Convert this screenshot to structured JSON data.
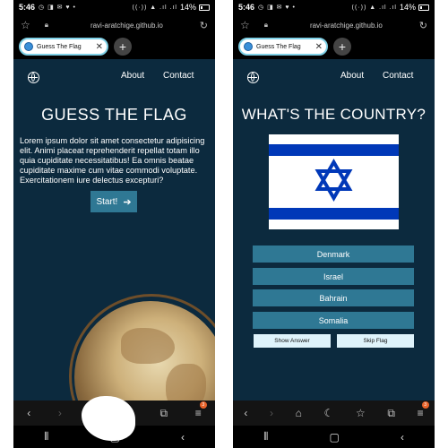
{
  "status_bar": {
    "time": "5:46",
    "notification_glyphs": "◷ ◨ ✉ ♥ •",
    "signal_glyphs": "((·)) ▲ .ıl .ıl",
    "battery": "14%"
  },
  "browser": {
    "url": "ravi-aratchige.github.io",
    "tab_title": "Guess The Flag"
  },
  "nav": {
    "about": "About",
    "contact": "Contact"
  },
  "landing": {
    "title": "GUESS THE FLAG",
    "text": "Lorem ipsum dolor sit amet consectetur adipisicing elit. Animi placeat reprehenderit repellat totam illo quia cupiditate necessitatibus! Ea omnis beatae cupiditate maxime cum vitae commodi voluptate. Exercitationem iure delectus excepturi?",
    "start_label": "Start!"
  },
  "quiz": {
    "title": "WHAT'S THE COUNTRY?",
    "flag_icon": "flag-of-israel",
    "answers": [
      "Denmark",
      "Israel",
      "Bahrain",
      "Somalia"
    ],
    "show_answer_label": "Show Answer",
    "skip_flag_label": "Skip Flag"
  },
  "browser_menu_badge": "3",
  "colors": {
    "page_bg": "#0c2a3e",
    "button": "#2f7894",
    "flag_blue": "#0038b8",
    "light_button": "#dff3fb"
  }
}
